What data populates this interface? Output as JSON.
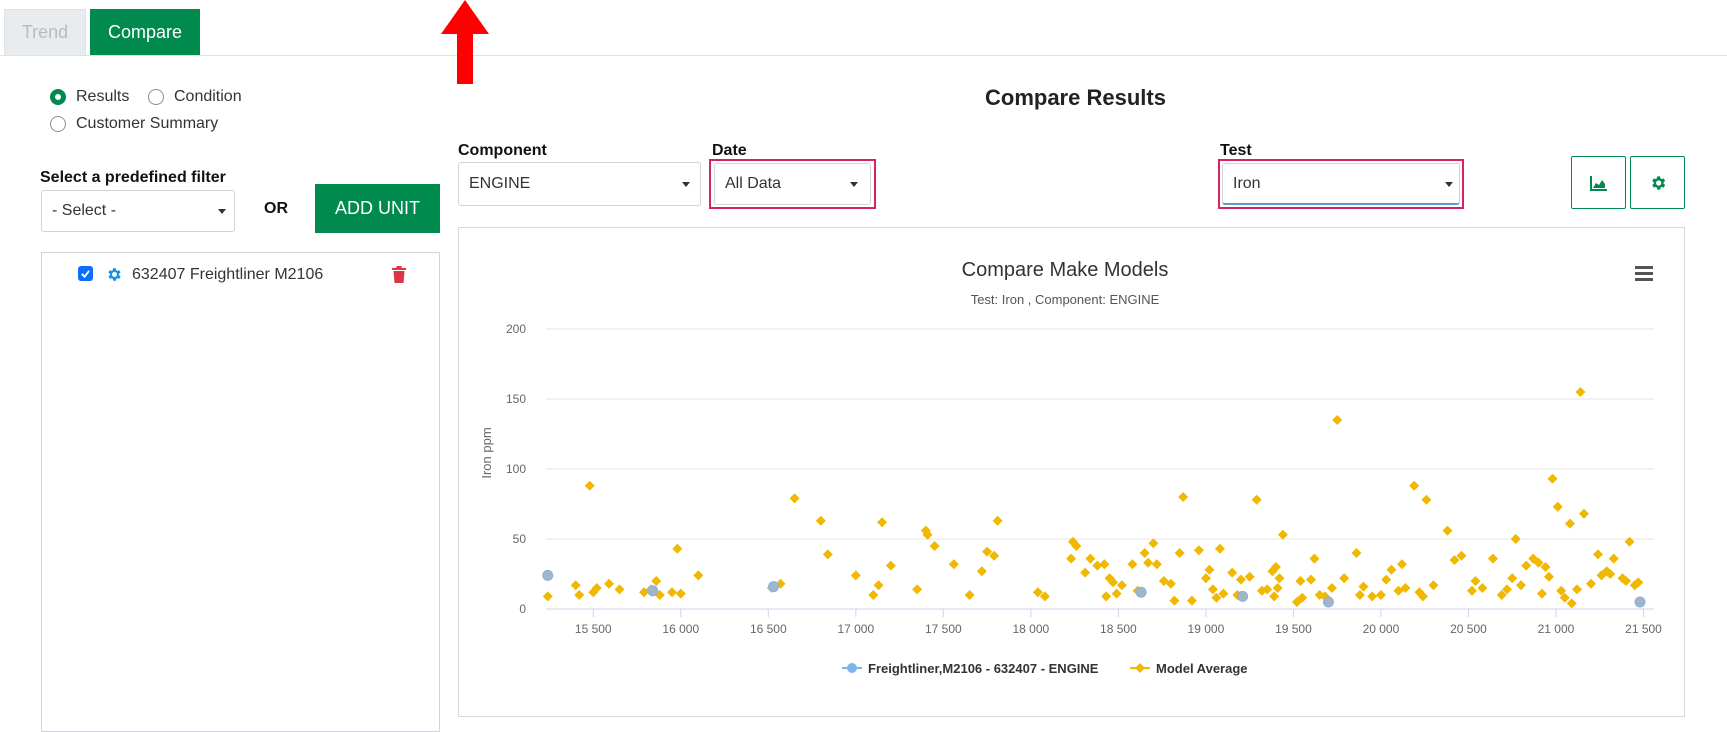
{
  "tabs": {
    "trend": "Trend",
    "compare": "Compare"
  },
  "radios": {
    "results": "Results",
    "condition": "Condition",
    "customer_summary": "Customer Summary",
    "selected": "results"
  },
  "filter": {
    "label": "Select a predefined filter",
    "value": "- Select -",
    "or": "OR",
    "add_unit": "ADD UNIT"
  },
  "units": [
    {
      "label": "632407 Freightliner M2106",
      "checked": true
    }
  ],
  "header": {
    "title": "Compare Results",
    "component_label": "Component",
    "component_value": "ENGINE",
    "date_label": "Date",
    "date_value": "All Data",
    "test_label": "Test",
    "test_value": "Iron"
  },
  "icons": {
    "chart_button": "area-chart-icon",
    "settings_button": "gear-icon",
    "unit_settings": "gear-icon",
    "delete": "trash-icon",
    "chart_menu": "hamburger-menu-icon"
  },
  "colors": {
    "accent": "#008a4e",
    "highlight": "#d6245f",
    "unit_series": "#7cb5ec",
    "model_average": "#f0b800",
    "delete": "#dc3545",
    "annotation_arrow": "#ff0000"
  },
  "chart_data": {
    "type": "scatter",
    "title": "Compare Make Models",
    "subtitle": "Test: Iron , Component: ENGINE",
    "xlabel": "",
    "ylabel": "Iron ppm",
    "xlim": [
      15230,
      21560
    ],
    "ylim": [
      0,
      200
    ],
    "x_ticks": [
      15500,
      16000,
      16500,
      17000,
      17500,
      18000,
      18500,
      19000,
      19500,
      20000,
      20500,
      21000,
      21500
    ],
    "x_tick_labels": [
      "15 500",
      "16 000",
      "16 500",
      "17 000",
      "17 500",
      "18 000",
      "18 500",
      "19 000",
      "19 500",
      "20 000",
      "20 500",
      "21 000",
      "21 500"
    ],
    "y_ticks": [
      0,
      50,
      100,
      150,
      200
    ],
    "grid": true,
    "legend_position": "bottom-center",
    "series": [
      {
        "name": "Freightliner,M2106 - 632407 - ENGINE",
        "color": "#7cb5ec",
        "marker": "circle",
        "points": [
          [
            15240,
            24
          ],
          [
            15840,
            13
          ],
          [
            16530,
            16
          ],
          [
            18630,
            12
          ],
          [
            19210,
            9
          ],
          [
            19700,
            5
          ],
          [
            21480,
            5
          ]
        ]
      },
      {
        "name": "Model Average",
        "color": "#f0b800",
        "marker": "diamond",
        "points": [
          [
            15240,
            9
          ],
          [
            15400,
            17
          ],
          [
            15420,
            10
          ],
          [
            15480,
            88
          ],
          [
            15500,
            12
          ],
          [
            15520,
            15
          ],
          [
            15590,
            18
          ],
          [
            15650,
            14
          ],
          [
            15790,
            12
          ],
          [
            15830,
            14
          ],
          [
            15860,
            20
          ],
          [
            15880,
            10
          ],
          [
            15950,
            12
          ],
          [
            15980,
            43
          ],
          [
            16000,
            11
          ],
          [
            16100,
            24
          ],
          [
            16520,
            15
          ],
          [
            16570,
            18
          ],
          [
            16650,
            79
          ],
          [
            16800,
            63
          ],
          [
            16840,
            39
          ],
          [
            17000,
            24
          ],
          [
            17100,
            10
          ],
          [
            17130,
            17
          ],
          [
            17150,
            62
          ],
          [
            17200,
            31
          ],
          [
            17350,
            14
          ],
          [
            17400,
            56
          ],
          [
            17410,
            53
          ],
          [
            17450,
            45
          ],
          [
            17560,
            32
          ],
          [
            17650,
            10
          ],
          [
            17720,
            27
          ],
          [
            17750,
            41
          ],
          [
            17790,
            38
          ],
          [
            17810,
            63
          ],
          [
            18040,
            12
          ],
          [
            18080,
            9
          ],
          [
            18230,
            36
          ],
          [
            18240,
            48
          ],
          [
            18260,
            45
          ],
          [
            18310,
            26
          ],
          [
            18340,
            36
          ],
          [
            18380,
            31
          ],
          [
            18420,
            32
          ],
          [
            18430,
            9
          ],
          [
            18450,
            22
          ],
          [
            18470,
            19
          ],
          [
            18490,
            11
          ],
          [
            18520,
            17
          ],
          [
            18580,
            32
          ],
          [
            18610,
            13
          ],
          [
            18650,
            40
          ],
          [
            18670,
            33
          ],
          [
            18700,
            47
          ],
          [
            18720,
            32
          ],
          [
            18760,
            20
          ],
          [
            18800,
            18
          ],
          [
            18820,
            6
          ],
          [
            18850,
            40
          ],
          [
            18870,
            80
          ],
          [
            18920,
            6
          ],
          [
            18960,
            42
          ],
          [
            19000,
            22
          ],
          [
            19020,
            28
          ],
          [
            19040,
            14
          ],
          [
            19060,
            8
          ],
          [
            19080,
            43
          ],
          [
            19100,
            11
          ],
          [
            19150,
            26
          ],
          [
            19180,
            10
          ],
          [
            19200,
            21
          ],
          [
            19250,
            23
          ],
          [
            19290,
            78
          ],
          [
            19320,
            13
          ],
          [
            19350,
            14
          ],
          [
            19380,
            27
          ],
          [
            19390,
            9
          ],
          [
            19400,
            30
          ],
          [
            19410,
            15
          ],
          [
            19420,
            22
          ],
          [
            19440,
            53
          ],
          [
            19520,
            5
          ],
          [
            19540,
            20
          ],
          [
            19550,
            8
          ],
          [
            19600,
            21
          ],
          [
            19620,
            36
          ],
          [
            19650,
            10
          ],
          [
            19680,
            9
          ],
          [
            19720,
            15
          ],
          [
            19750,
            135
          ],
          [
            19790,
            22
          ],
          [
            19860,
            40
          ],
          [
            19880,
            10
          ],
          [
            19900,
            16
          ],
          [
            19950,
            9
          ],
          [
            20000,
            10
          ],
          [
            20030,
            21
          ],
          [
            20060,
            28
          ],
          [
            20100,
            13
          ],
          [
            20120,
            32
          ],
          [
            20140,
            15
          ],
          [
            20190,
            88
          ],
          [
            20220,
            12
          ],
          [
            20240,
            9
          ],
          [
            20260,
            78
          ],
          [
            20300,
            17
          ],
          [
            20380,
            56
          ],
          [
            20420,
            35
          ],
          [
            20460,
            38
          ],
          [
            20520,
            13
          ],
          [
            20540,
            20
          ],
          [
            20580,
            15
          ],
          [
            20640,
            36
          ],
          [
            20690,
            10
          ],
          [
            20720,
            14
          ],
          [
            20750,
            22
          ],
          [
            20770,
            50
          ],
          [
            20800,
            17
          ],
          [
            20830,
            31
          ],
          [
            20870,
            36
          ],
          [
            20900,
            33
          ],
          [
            20920,
            11
          ],
          [
            20940,
            30
          ],
          [
            20960,
            23
          ],
          [
            20980,
            93
          ],
          [
            21010,
            73
          ],
          [
            21030,
            13
          ],
          [
            21050,
            8
          ],
          [
            21080,
            61
          ],
          [
            21090,
            4
          ],
          [
            21120,
            14
          ],
          [
            21140,
            155
          ],
          [
            21160,
            68
          ],
          [
            21200,
            18
          ],
          [
            21240,
            39
          ],
          [
            21260,
            24
          ],
          [
            21290,
            27
          ],
          [
            21310,
            25
          ],
          [
            21330,
            36
          ],
          [
            21380,
            22
          ],
          [
            21400,
            20
          ],
          [
            21420,
            48
          ],
          [
            21450,
            17
          ],
          [
            21470,
            19
          ]
        ]
      }
    ]
  }
}
